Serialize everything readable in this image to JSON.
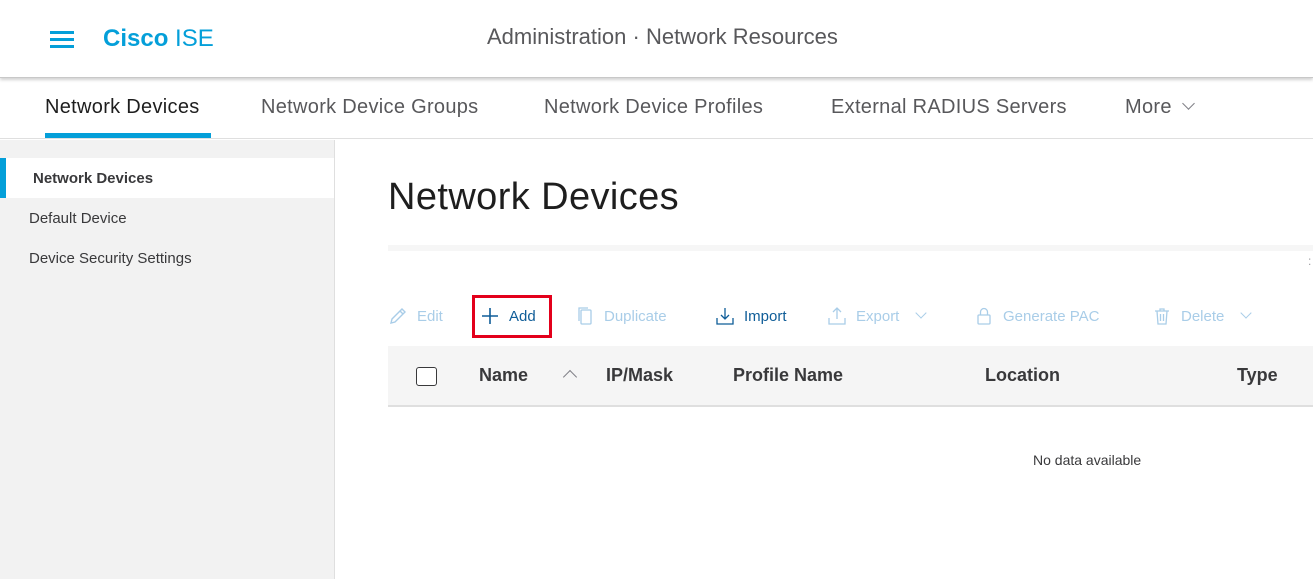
{
  "header": {
    "brand_bold": "Cisco",
    "brand_light": "ISE",
    "title": "Administration · Network Resources"
  },
  "tabs": [
    {
      "label": "Network Devices",
      "active": true
    },
    {
      "label": "Network Device Groups"
    },
    {
      "label": "Network Device Profiles"
    },
    {
      "label": "External RADIUS Servers"
    },
    {
      "label": "More"
    }
  ],
  "sidebar": {
    "items": [
      {
        "label": "Network Devices",
        "active": true
      },
      {
        "label": "Default Device"
      },
      {
        "label": "Device Security Settings"
      }
    ]
  },
  "main": {
    "title": "Network Devices",
    "edge_mark": ":",
    "toolbar": {
      "edit": "Edit",
      "add": "Add",
      "duplicate": "Duplicate",
      "import": "Import",
      "export": "Export",
      "generate_pac": "Generate PAC",
      "delete": "Delete"
    },
    "table": {
      "columns": [
        "Name",
        "IP/Mask",
        "Profile Name",
        "Location",
        "Type"
      ],
      "empty_text": "No data available"
    }
  },
  "colors": {
    "accent": "#049fd9",
    "link_enabled": "#0f5d98",
    "link_disabled": "#a9cde8",
    "highlight": "#e3001b"
  },
  "icons": {
    "menu": "hamburger-icon",
    "edit": "pencil-icon",
    "add": "plus-icon",
    "duplicate": "copy-icon",
    "import": "import-icon",
    "export": "export-icon",
    "generate_pac": "lock-icon",
    "delete": "trash-icon"
  }
}
